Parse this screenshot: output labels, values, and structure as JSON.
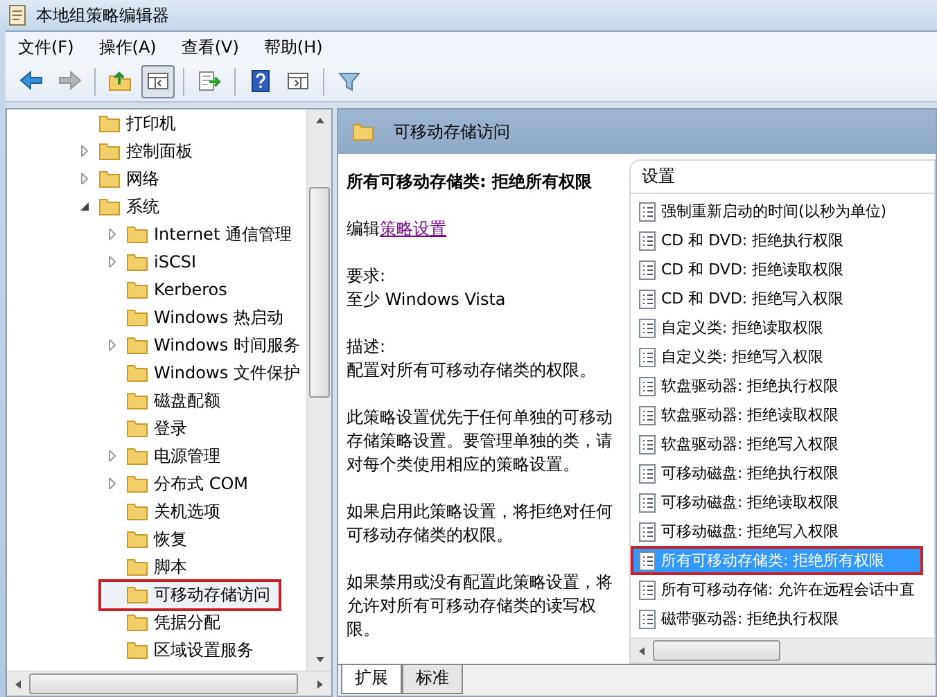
{
  "window": {
    "title": "本地组策略编辑器"
  },
  "menu": [
    "文件(F)",
    "操作(A)",
    "查看(V)",
    "帮助(H)"
  ],
  "toolbar": [
    [
      {
        "kind": "back",
        "pressed": false,
        "disabled": false
      },
      {
        "kind": "forward",
        "pressed": false,
        "disabled": true
      }
    ],
    [
      {
        "kind": "up",
        "pressed": false,
        "disabled": false
      },
      {
        "kind": "tree_toggle",
        "pressed": true,
        "disabled": false
      }
    ],
    [
      {
        "kind": "export",
        "pressed": false,
        "disabled": false
      }
    ],
    [
      {
        "kind": "help",
        "pressed": false,
        "disabled": false
      },
      {
        "kind": "action_pane",
        "pressed": false,
        "disabled": false
      }
    ],
    [
      {
        "kind": "filter",
        "pressed": false,
        "disabled": false
      }
    ]
  ],
  "tree": {
    "items": [
      {
        "label": "打印机",
        "has_children": false,
        "expanded": false,
        "selected": false,
        "marked": false
      },
      {
        "label": "控制面板",
        "has_children": true,
        "expanded": false,
        "selected": false,
        "marked": false
      },
      {
        "label": "网络",
        "has_children": true,
        "expanded": false,
        "selected": false,
        "marked": false
      },
      {
        "label": "系统",
        "has_children": true,
        "expanded": true,
        "selected": false,
        "marked": false,
        "children": [
          {
            "label": "Internet 通信管理",
            "has_children": true,
            "expanded": false,
            "selected": false,
            "marked": false
          },
          {
            "label": "iSCSI",
            "has_children": true,
            "expanded": false,
            "selected": false,
            "marked": false
          },
          {
            "label": "Kerberos",
            "has_children": false,
            "expanded": false,
            "selected": false,
            "marked": false
          },
          {
            "label": "Windows 热启动",
            "has_children": false,
            "expanded": false,
            "selected": false,
            "marked": false
          },
          {
            "label": "Windows 时间服务",
            "has_children": true,
            "expanded": false,
            "selected": false,
            "marked": false
          },
          {
            "label": "Windows 文件保护",
            "has_children": false,
            "expanded": false,
            "selected": false,
            "marked": false
          },
          {
            "label": "磁盘配额",
            "has_children": false,
            "expanded": false,
            "selected": false,
            "marked": false
          },
          {
            "label": "登录",
            "has_children": false,
            "expanded": false,
            "selected": false,
            "marked": false
          },
          {
            "label": "电源管理",
            "has_children": true,
            "expanded": false,
            "selected": false,
            "marked": false
          },
          {
            "label": "分布式 COM",
            "has_children": true,
            "expanded": false,
            "selected": false,
            "marked": false
          },
          {
            "label": "关机选项",
            "has_children": false,
            "expanded": false,
            "selected": false,
            "marked": false
          },
          {
            "label": "恢复",
            "has_children": false,
            "expanded": false,
            "selected": false,
            "marked": false
          },
          {
            "label": "脚本",
            "has_children": false,
            "expanded": false,
            "selected": false,
            "marked": false
          },
          {
            "label": "可移动存储访问",
            "has_children": false,
            "expanded": false,
            "selected": true,
            "marked": true
          },
          {
            "label": "凭据分配",
            "has_children": false,
            "expanded": false,
            "selected": false,
            "marked": false
          },
          {
            "label": "区域设置服务",
            "has_children": false,
            "expanded": false,
            "selected": false,
            "marked": false
          }
        ]
      }
    ]
  },
  "detail": {
    "header": "可移动存储访问",
    "title": "所有可移动存储类: 拒绝所有权限",
    "edit_prefix": "编辑",
    "edit_link": "策略设置",
    "requirements_label": "要求:",
    "requirements": "至少 Windows Vista",
    "description_label": "描述:",
    "paragraphs": [
      "配置对所有可移动存储类的权限。",
      "此策略设置优先于任何单独的可移动存储策略设置。要管理单独的类，请对每个类使用相应的策略设置。",
      "如果启用此策略设置，将拒绝对任何可移动存储类的权限。",
      "如果禁用或没有配置此策略设置，将允许对所有可移动存储类的读写权限。"
    ]
  },
  "settings": {
    "column": "设置",
    "items": [
      {
        "label": "强制重新启动的时间(以秒为单位)",
        "selected": false,
        "marked": false
      },
      {
        "label": "CD 和 DVD: 拒绝执行权限",
        "selected": false,
        "marked": false
      },
      {
        "label": "CD 和 DVD: 拒绝读取权限",
        "selected": false,
        "marked": false
      },
      {
        "label": "CD 和 DVD: 拒绝写入权限",
        "selected": false,
        "marked": false
      },
      {
        "label": "自定义类: 拒绝读取权限",
        "selected": false,
        "marked": false
      },
      {
        "label": "自定义类: 拒绝写入权限",
        "selected": false,
        "marked": false
      },
      {
        "label": "软盘驱动器: 拒绝执行权限",
        "selected": false,
        "marked": false
      },
      {
        "label": "软盘驱动器: 拒绝读取权限",
        "selected": false,
        "marked": false
      },
      {
        "label": "软盘驱动器: 拒绝写入权限",
        "selected": false,
        "marked": false
      },
      {
        "label": "可移动磁盘: 拒绝执行权限",
        "selected": false,
        "marked": false
      },
      {
        "label": "可移动磁盘: 拒绝读取权限",
        "selected": false,
        "marked": false
      },
      {
        "label": "可移动磁盘: 拒绝写入权限",
        "selected": false,
        "marked": false
      },
      {
        "label": "所有可移动存储类: 拒绝所有权限",
        "selected": true,
        "marked": true
      },
      {
        "label": "所有可移动存储: 允许在远程会话中直",
        "selected": false,
        "marked": false
      },
      {
        "label": "磁带驱动器: 拒绝执行权限",
        "selected": false,
        "marked": false
      }
    ]
  },
  "tabs": [
    {
      "label": "扩展",
      "selected": true
    },
    {
      "label": "标准",
      "selected": false
    }
  ]
}
